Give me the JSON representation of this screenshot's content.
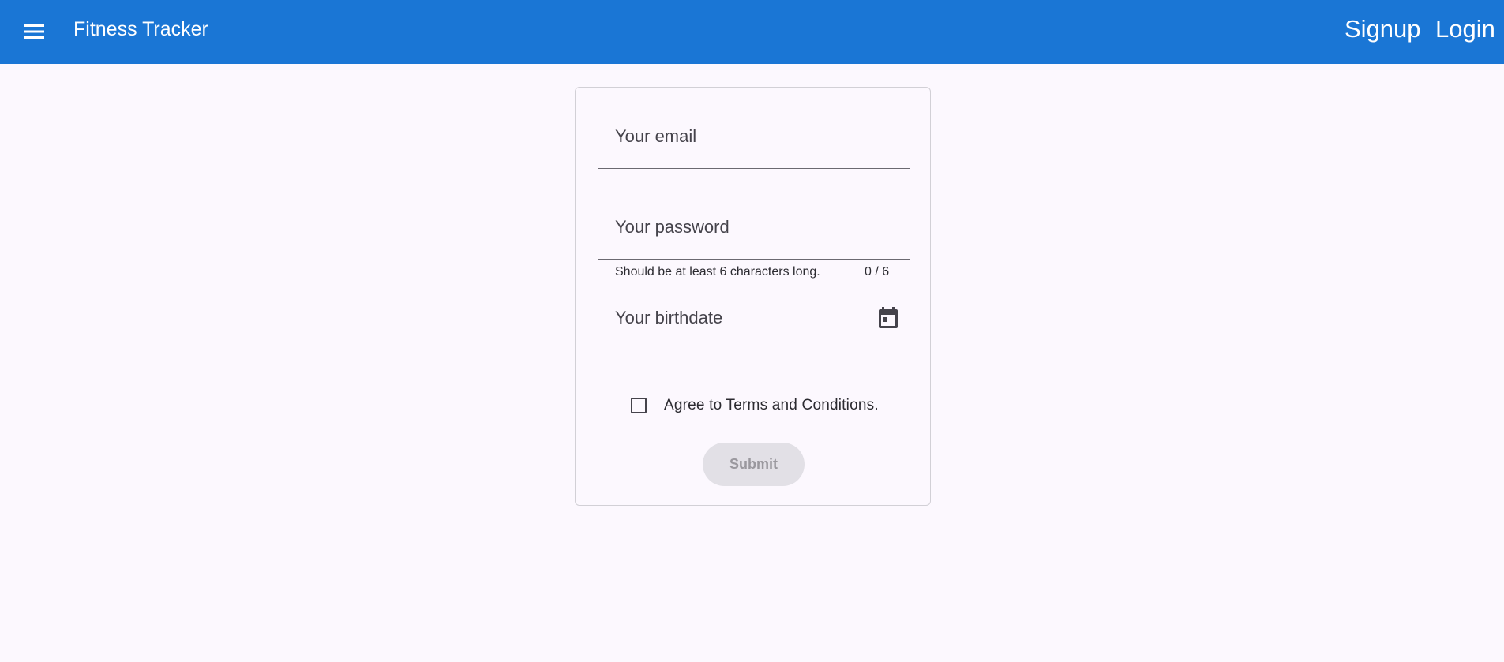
{
  "toolbar": {
    "menu_icon": "menu-icon",
    "title": "Fitness Tracker",
    "signup_label": "Signup",
    "login_label": "Login",
    "background_color": "#1a76d5"
  },
  "signup_form": {
    "email": {
      "placeholder": "Your email",
      "value": ""
    },
    "password": {
      "placeholder": "Your password",
      "value": "",
      "hint": "Should be at least 6 characters long.",
      "counter": "0 / 6"
    },
    "birthdate": {
      "placeholder": "Your birthdate",
      "value": "",
      "icon": "calendar-icon"
    },
    "terms": {
      "label": "Agree to Terms and Conditions.",
      "checked": false
    },
    "submit_label": "Submit",
    "submit_disabled": true
  }
}
